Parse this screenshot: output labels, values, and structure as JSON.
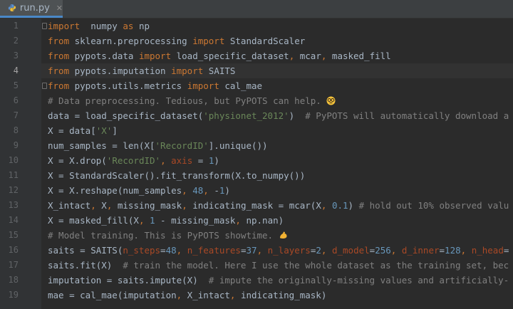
{
  "tab": {
    "filename": "run.py",
    "close_glyph": "✕",
    "icon": "python-file-icon"
  },
  "colors": {
    "background": "#2b2b2b",
    "gutter": "#313335",
    "keyword": "#cc7832",
    "string": "#6a8759",
    "number": "#6897bb",
    "comment": "#808080",
    "param": "#aa4926",
    "text": "#a9b7c6"
  },
  "editor": {
    "current_line": 4,
    "lines": [
      {
        "num": "1",
        "tokens": [
          [
            "kw",
            "import"
          ],
          [
            "",
            "  numpy "
          ],
          [
            "kw",
            "as"
          ],
          [
            "",
            " np"
          ]
        ]
      },
      {
        "num": "2",
        "tokens": [
          [
            "kw",
            "from"
          ],
          [
            "",
            " sklearn.preprocessing "
          ],
          [
            "kw",
            "import"
          ],
          [
            "",
            " StandardScaler"
          ]
        ]
      },
      {
        "num": "3",
        "tokens": [
          [
            "kw",
            "from"
          ],
          [
            "",
            " pypots.data "
          ],
          [
            "kw",
            "import"
          ],
          [
            "",
            " load_specific_dataset"
          ],
          [
            "kw",
            ","
          ],
          [
            "",
            " mcar"
          ],
          [
            "kw",
            ","
          ],
          [
            "",
            " masked_fill"
          ]
        ]
      },
      {
        "num": "4",
        "tokens": [
          [
            "kw",
            "from"
          ],
          [
            "",
            " pypots.imputation "
          ],
          [
            "kw",
            "import"
          ],
          [
            "",
            " SAITS"
          ]
        ]
      },
      {
        "num": "5",
        "tokens": [
          [
            "kw",
            "from"
          ],
          [
            "",
            " pypots.utils.metrics "
          ],
          [
            "kw",
            "import"
          ],
          [
            "",
            " cal_mae"
          ]
        ]
      },
      {
        "num": "6",
        "tokens": [
          [
            "cmt",
            "# Data preprocessing. Tedious, but PyPOTS can help. "
          ],
          [
            "emoji",
            "nerd-face-emoji"
          ]
        ]
      },
      {
        "num": "7",
        "tokens": [
          [
            "",
            "data = load_specific_dataset("
          ],
          [
            "str",
            "'physionet_2012'"
          ],
          [
            "",
            ")  "
          ],
          [
            "cmt",
            "# PyPOTS will automatically download a"
          ]
        ]
      },
      {
        "num": "8",
        "tokens": [
          [
            "",
            "X = data["
          ],
          [
            "str",
            "'X'"
          ],
          [
            "",
            "]"
          ]
        ]
      },
      {
        "num": "9",
        "tokens": [
          [
            "",
            "num_samples = len(X["
          ],
          [
            "str",
            "'RecordID'"
          ],
          [
            "",
            "].unique())"
          ]
        ]
      },
      {
        "num": "10",
        "tokens": [
          [
            "",
            "X = X.drop("
          ],
          [
            "str",
            "'RecordID'"
          ],
          [
            "kw",
            ","
          ],
          [
            "",
            " "
          ],
          [
            "param",
            "axis"
          ],
          [
            "",
            " = "
          ],
          [
            "num",
            "1"
          ],
          [
            "",
            ")"
          ]
        ]
      },
      {
        "num": "11",
        "tokens": [
          [
            "",
            "X = StandardScaler().fit_transform(X.to_numpy())"
          ]
        ]
      },
      {
        "num": "12",
        "tokens": [
          [
            "",
            "X = X.reshape(num_samples"
          ],
          [
            "kw",
            ","
          ],
          [
            "",
            " "
          ],
          [
            "num",
            "48"
          ],
          [
            "kw",
            ","
          ],
          [
            "",
            " -"
          ],
          [
            "num",
            "1"
          ],
          [
            "",
            ")"
          ]
        ]
      },
      {
        "num": "13",
        "tokens": [
          [
            "",
            "X_intact"
          ],
          [
            "kw",
            ","
          ],
          [
            "",
            " X"
          ],
          [
            "kw",
            ","
          ],
          [
            "",
            " missing_mask"
          ],
          [
            "kw",
            ","
          ],
          [
            "",
            " indicating_mask = mcar(X"
          ],
          [
            "kw",
            ","
          ],
          [
            "",
            " "
          ],
          [
            "num",
            "0.1"
          ],
          [
            "",
            ") "
          ],
          [
            "cmt",
            "# hold out 10% observed valu"
          ]
        ]
      },
      {
        "num": "14",
        "tokens": [
          [
            "",
            "X = masked_fill(X"
          ],
          [
            "kw",
            ","
          ],
          [
            "",
            " "
          ],
          [
            "num",
            "1"
          ],
          [
            "",
            " - missing_mask"
          ],
          [
            "kw",
            ","
          ],
          [
            "",
            " np.nan)"
          ]
        ]
      },
      {
        "num": "15",
        "tokens": [
          [
            "cmt",
            "# Model training. This is PyPOTS showtime. "
          ],
          [
            "emoji",
            "flexed-biceps-emoji"
          ]
        ]
      },
      {
        "num": "16",
        "tokens": [
          [
            "",
            "saits = SAITS("
          ],
          [
            "param",
            "n_steps"
          ],
          [
            "",
            "="
          ],
          [
            "num",
            "48"
          ],
          [
            "kw",
            ","
          ],
          [
            "",
            " "
          ],
          [
            "param",
            "n_features"
          ],
          [
            "",
            "="
          ],
          [
            "num",
            "37"
          ],
          [
            "kw",
            ","
          ],
          [
            "",
            " "
          ],
          [
            "param",
            "n_layers"
          ],
          [
            "",
            "="
          ],
          [
            "num",
            "2"
          ],
          [
            "kw",
            ","
          ],
          [
            "",
            " "
          ],
          [
            "param",
            "d_model"
          ],
          [
            "",
            "="
          ],
          [
            "num",
            "256"
          ],
          [
            "kw",
            ","
          ],
          [
            "",
            " "
          ],
          [
            "param",
            "d_inner"
          ],
          [
            "",
            "="
          ],
          [
            "num",
            "128"
          ],
          [
            "kw",
            ","
          ],
          [
            "",
            " "
          ],
          [
            "param",
            "n_head"
          ],
          [
            "",
            "="
          ]
        ]
      },
      {
        "num": "17",
        "tokens": [
          [
            "",
            "saits.fit(X)  "
          ],
          [
            "cmt",
            "# train the model. Here I use the whole dataset as the training set, bec"
          ]
        ]
      },
      {
        "num": "18",
        "tokens": [
          [
            "",
            "imputation = saits.impute(X)  "
          ],
          [
            "cmt",
            "# impute the originally-missing values and artificially-"
          ]
        ]
      },
      {
        "num": "19",
        "tokens": [
          [
            "",
            "mae = cal_mae(imputation"
          ],
          [
            "kw",
            ","
          ],
          [
            "",
            " X_intact"
          ],
          [
            "kw",
            ","
          ],
          [
            "",
            " indicating_mask)"
          ]
        ]
      }
    ]
  }
}
